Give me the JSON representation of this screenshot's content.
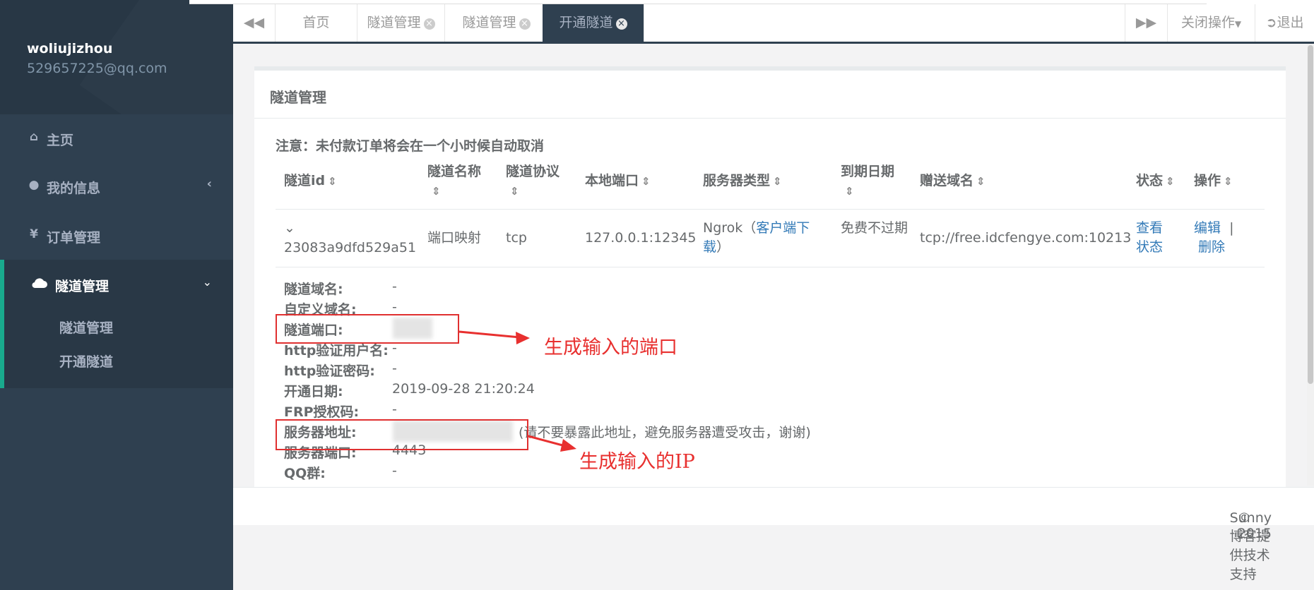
{
  "sidebar": {
    "username": "woliujizhou",
    "email": "529657225@qq.com",
    "items": [
      {
        "icon": "home-icon",
        "label": "主页"
      },
      {
        "icon": "user-icon",
        "label": "我的信息"
      },
      {
        "icon": "yen-icon",
        "label": "订单管理"
      },
      {
        "icon": "cloud-icon",
        "label": "隧道管理"
      }
    ],
    "subitems": [
      "隧道管理",
      "开通隧道"
    ]
  },
  "topbar": {
    "tabs": [
      "首页",
      "隧道管理",
      "隧道管理",
      "开通隧道"
    ],
    "close_ops": "关闭操作",
    "logout": "退出"
  },
  "panel": {
    "title": "隧道管理",
    "notice": "注意：未付款订单将会在一个小时候自动取消"
  },
  "table": {
    "headers": [
      "隧道id",
      "隧道名称",
      "隧道协议",
      "本地端口",
      "服务器类型",
      "到期日期",
      "赠送域名",
      "状态",
      "操作"
    ],
    "row": {
      "id": "23083a9dfd529a51",
      "name": "端口映射",
      "protocol": "tcp",
      "local_port": "127.0.0.1:12345",
      "server_type_prefix": "Ngrok（",
      "server_type_link": "客户端下载",
      "server_type_suffix": "）",
      "expire": "免费不过期",
      "domain": "tcp://free.idcfengye.com:10213",
      "status_link": "查看状态",
      "edit": "编辑",
      "sep": "|",
      "delete": "删除"
    }
  },
  "details": [
    {
      "label": "隧道域名:",
      "value": "-"
    },
    {
      "label": "自定义域名:",
      "value": "-"
    },
    {
      "label": "隧道端口:",
      "value": ""
    },
    {
      "label": "http验证用户名:",
      "value": "-"
    },
    {
      "label": "http验证密码:",
      "value": "-"
    },
    {
      "label": "开通日期:",
      "value": "2019-09-28 21:20:24"
    },
    {
      "label": "FRP授权码:",
      "value": "-"
    },
    {
      "label": "服务器地址:",
      "value": "(请不要暴露此地址，避免服务器遭受攻击，谢谢)"
    },
    {
      "label": "服务器端口:",
      "value": "4443"
    },
    {
      "label": "QQ群:",
      "value": "-"
    }
  ],
  "annotations": {
    "port": "生成输入的端口",
    "ip": "生成输入的IP"
  },
  "footer": {
    "prefix": "© 2015 ",
    "link": "Sunny博客提供技术支持"
  },
  "colors": {
    "sidebar": "#2f4050",
    "accent": "#19aa8d",
    "link": "#337ab7",
    "annotation": "#e8302f"
  }
}
